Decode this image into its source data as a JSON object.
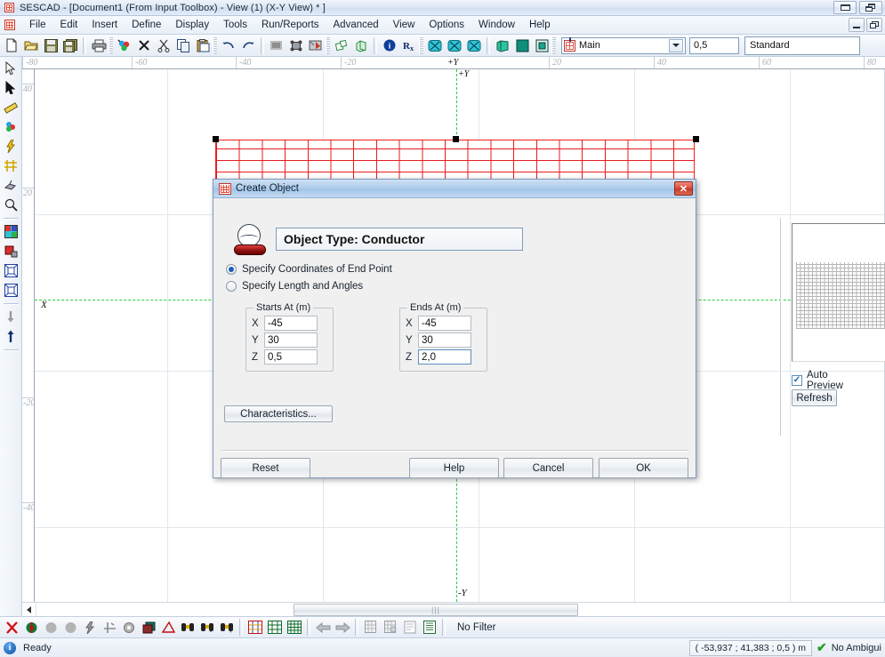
{
  "window": {
    "title": "SESCAD - [Document1 (From Input Toolbox) - View (1) (X-Y View) * ]",
    "app_icon": "building-grid-icon",
    "restore_button": "restore-icon",
    "cascade_button": "cascade-icon",
    "mdi_minimize": "minimize-icon",
    "mdi_restore": "mdi-restore-icon"
  },
  "menubar": {
    "icon": "document-grid-icon",
    "items": [
      {
        "label": "File"
      },
      {
        "label": "Edit"
      },
      {
        "label": "Insert"
      },
      {
        "label": "Define"
      },
      {
        "label": "Display"
      },
      {
        "label": "Tools"
      },
      {
        "label": "Run/Reports"
      },
      {
        "label": "Advanced"
      },
      {
        "label": "View"
      },
      {
        "label": "Options"
      },
      {
        "label": "Window"
      },
      {
        "label": "Help"
      }
    ]
  },
  "toolbar": {
    "buttons": [
      {
        "name": "new-file-icon"
      },
      {
        "name": "open-folder-icon"
      },
      {
        "name": "save-disk-icon"
      },
      {
        "name": "save-all-icon"
      },
      {
        "name": "print-icon"
      },
      {
        "name": "select-objects-icon"
      },
      {
        "name": "delete-x-icon"
      },
      {
        "name": "cut-scissors-icon"
      },
      {
        "name": "copy-icon"
      },
      {
        "name": "paste-icon"
      },
      {
        "name": "undo-icon"
      },
      {
        "name": "redo-icon"
      },
      {
        "name": "region-select-icon"
      },
      {
        "name": "node-select-icon"
      },
      {
        "name": "mesh-edit-icon"
      },
      {
        "name": "extrude-2d-icon"
      },
      {
        "name": "extrude-3d-icon"
      },
      {
        "name": "info-icon"
      },
      {
        "name": "rx-icon"
      },
      {
        "name": "view-xy-icon"
      },
      {
        "name": "view-xz-icon"
      },
      {
        "name": "view-yz-icon"
      },
      {
        "name": "view-3d-icon"
      },
      {
        "name": "fill-solid-icon"
      },
      {
        "name": "fill-outline-icon"
      }
    ],
    "layer_combo": {
      "icon": "grid-layer-icon",
      "value": "Main"
    },
    "size_field": {
      "value": "0,5"
    },
    "style_field": {
      "value": "Standard"
    }
  },
  "left_toolbar": {
    "buttons": [
      {
        "name": "pointer-arrow-icon"
      },
      {
        "name": "select-arrow-icon"
      },
      {
        "name": "ruler-icon"
      },
      {
        "name": "paint-object-icon"
      },
      {
        "name": "lightning-icon"
      },
      {
        "name": "conductor-cross-icon"
      },
      {
        "name": "swarm-icon"
      },
      {
        "name": "magnifier-icon"
      },
      {
        "name": "color-palette-icon"
      },
      {
        "name": "stamp-icon"
      },
      {
        "name": "fit-window-icon"
      },
      {
        "name": "zoom-extent-icon"
      },
      {
        "name": "arrow-down-icon"
      },
      {
        "name": "arrow-up-icon"
      }
    ]
  },
  "canvas": {
    "ruler_h_labels": [
      "-80",
      "-60",
      "-40",
      "-20",
      "+Y",
      "20",
      "40",
      "60",
      "80"
    ],
    "ruler_v_labels": [
      "40",
      "20",
      "",
      "-20",
      "-40"
    ],
    "axis_origin_label_x": "X",
    "axis_origin_label_y": "+Y",
    "axis_bottom_label": "-Y",
    "axis_color": "#2ecc40",
    "object_color": "#e81c1c",
    "scrollbar_thumb": "|||"
  },
  "bottom_toolbar": {
    "buttons": [
      {
        "name": "delete-red-x-icon"
      },
      {
        "name": "ground-sphere-icon"
      },
      {
        "name": "gray-sphere-icon"
      },
      {
        "name": "gray-sphere-2-icon"
      },
      {
        "name": "lightning-bolt-icon"
      },
      {
        "name": "conductor-icon"
      },
      {
        "name": "node-circle-icon"
      },
      {
        "name": "layers-icon"
      },
      {
        "name": "angle-icon"
      },
      {
        "name": "binoculars-icon"
      },
      {
        "name": "binoculars-t-icon"
      },
      {
        "name": "binoculars-y-icon"
      },
      {
        "name": "grid-color-icon"
      },
      {
        "name": "grid-green-icon"
      },
      {
        "name": "grid-plain-icon"
      },
      {
        "name": "arrow-left-icon"
      },
      {
        "name": "arrow-right-icon"
      },
      {
        "name": "table-select-icon"
      },
      {
        "name": "table-filter-icon"
      },
      {
        "name": "properties-icon"
      },
      {
        "name": "list-view-icon"
      }
    ],
    "filter_label": "No Filter"
  },
  "statusbar": {
    "icon": "info-icon",
    "status": "Ready",
    "coordinates": "(  -53,937  ;  41,383  ;    0,5    ) m",
    "check_icon": "checkmark-icon",
    "ambiguity": "No Ambigui"
  },
  "dialog": {
    "icon": "create-object-icon",
    "title": "Create Object",
    "close_label": "✕",
    "object_icon": "conductor-object-icon",
    "object_type": "Object Type: Conductor",
    "radios": [
      {
        "label": "Specify Coordinates of End Point",
        "selected": true
      },
      {
        "label": "Specify Length and Angles",
        "selected": false
      }
    ],
    "starts_at": {
      "legend": "Starts At (m)",
      "fields": [
        {
          "label": "X",
          "value": "-45"
        },
        {
          "label": "Y",
          "value": "30"
        },
        {
          "label": "Z",
          "value": "0,5"
        }
      ]
    },
    "ends_at": {
      "legend": "Ends At (m)",
      "fields": [
        {
          "label": "X",
          "value": "-45"
        },
        {
          "label": "Y",
          "value": "30"
        },
        {
          "label": "Z",
          "value": "2,0",
          "focused": true
        }
      ]
    },
    "characteristics_label": "Characteristics...",
    "auto_preview_label": "Auto Preview",
    "auto_preview_checked": true,
    "refresh_label": "Refresh",
    "reset_label": "Reset",
    "help_label": "Help",
    "cancel_label": "Cancel",
    "ok_label": "OK"
  }
}
